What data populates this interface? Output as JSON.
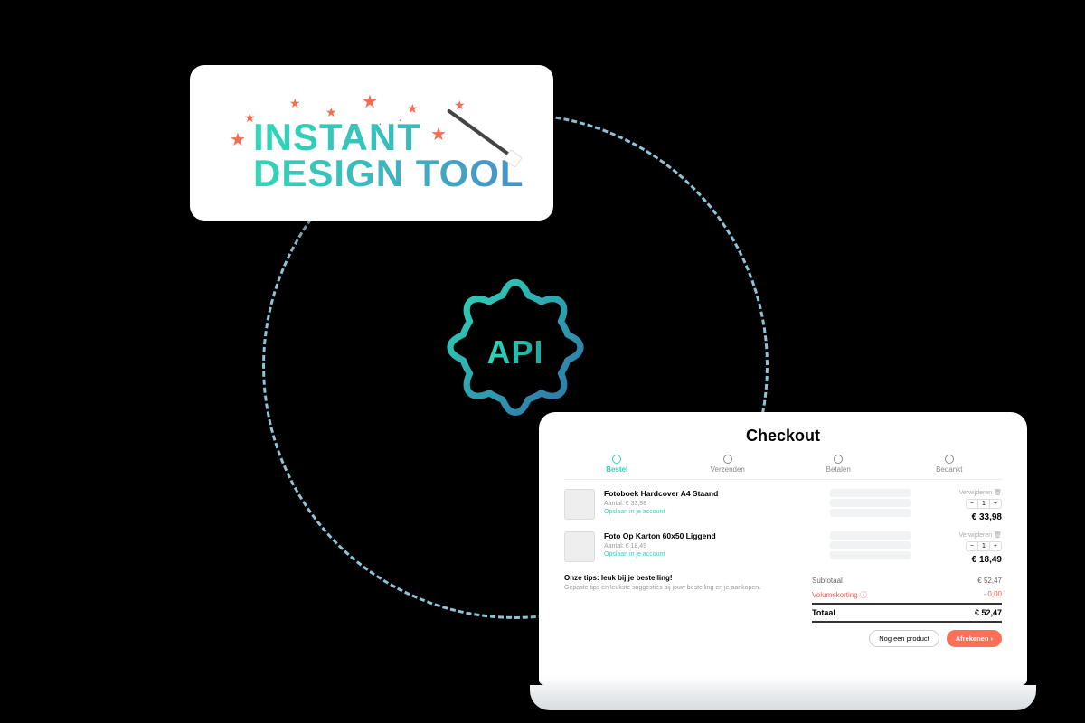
{
  "logo": {
    "line1": "INSTANT",
    "line2": "DESIGN TOOL"
  },
  "center": {
    "label": "API"
  },
  "checkout": {
    "title": "Checkout",
    "steps": [
      "Bestel",
      "Verzenden",
      "Betalen",
      "Bedankt"
    ],
    "active_step_index": 0,
    "items": [
      {
        "name": "Fotoboek Hardcover A4 Staand",
        "subtitle": "",
        "meta1": "Aantal: € 33,98",
        "meta2": "Opslaan in je account",
        "delete_label": "Verwijderen",
        "qty": 1,
        "price": "€ 33,98"
      },
      {
        "name": "Foto Op Karton 60x50 Liggend",
        "subtitle": "",
        "meta1": "Aantal: € 18,49",
        "meta2": "Opslaan in je account",
        "delete_label": "Verwijderen",
        "qty": 1,
        "price": "€ 18,49"
      }
    ],
    "tips": {
      "heading": "Onze tips: leuk bij je bestelling!",
      "text": "Gepaste tips en leukste suggesties bij jouw bestelling en je aankopen."
    },
    "totals": {
      "subtotal_label": "Subtotaal",
      "subtotal": "€ 52,47",
      "discount_label": "Volumekorting",
      "discount": "- 0,00",
      "total_label": "Totaal",
      "total": "€ 52,47"
    },
    "actions": {
      "continue": "Nog een product",
      "pay": "Afrekenen"
    }
  },
  "icons": {
    "trash": "🗑",
    "info": "ⓘ"
  },
  "colors": {
    "accent": "#2fd7b7",
    "accent2": "#4a90c9",
    "orange": "#ff6f57"
  }
}
